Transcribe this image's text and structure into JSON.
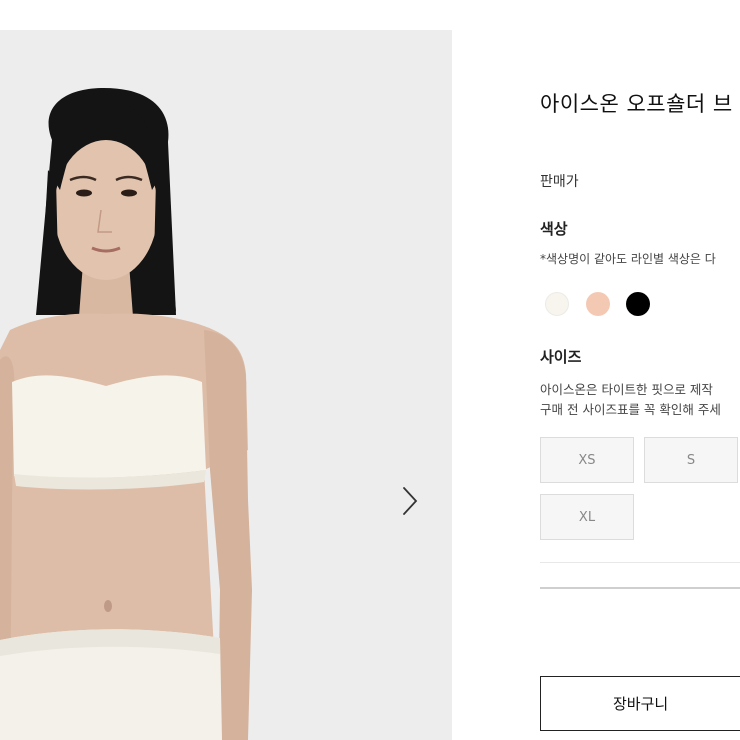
{
  "product": {
    "title": "아이스온 오프숄더 브",
    "price_label": "판매가",
    "color_label": "색상",
    "color_note": "*색상명이 같아도 라인별 색상은 다",
    "colors": [
      {
        "icon": "ivory-swatch",
        "hex": "#f7f5ee"
      },
      {
        "icon": "nude-swatch",
        "hex": "#f3c9b4"
      },
      {
        "icon": "black-swatch",
        "hex": "#000000"
      }
    ],
    "size_label": "사이즈",
    "size_note": [
      "아이스온은 타이트한 핏으로 제작",
      "구매 전 사이즈표를 꼭 확인해 주세"
    ],
    "sizes": [
      "XS",
      "S",
      "XL"
    ],
    "cart_label": "장바구니"
  },
  "gallery": {
    "next_icon": "chevron-right-icon",
    "background": "#ededed"
  }
}
